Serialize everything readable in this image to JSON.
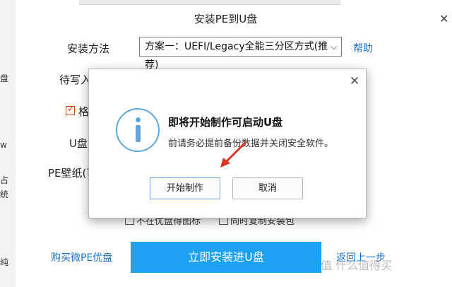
{
  "background_fragments": [
    "盘",
    "w",
    "占",
    "统",
    "纯"
  ],
  "window": {
    "title": "安装PE到U盘",
    "close_glyph": "✕"
  },
  "form": {
    "method_label": "安装方法",
    "method_value": "方案一：UEFI/Legacy全能三分区方式(推荐)",
    "help_link": "帮助",
    "target_label": "待写入",
    "format_label": "格",
    "udisk_label": "U盘",
    "wallpaper_label": "PE壁纸(可",
    "option_a": "不在优盘得图标",
    "option_b": "同时复制安装包"
  },
  "footer": {
    "buy_link": "购买微PE优盘",
    "install_button": "立即安装进U盘",
    "back_link": "返回上一步",
    "watermark": "值 什么值得买"
  },
  "dialog": {
    "close_glyph": "✕",
    "title": "即将开始制作可启动U盘",
    "message": "前请务必提前备份数据并关闭安全软件。",
    "start_button": "开始制作",
    "cancel_button": "取消"
  },
  "colors": {
    "link": "#1a73c8",
    "install_button": "#1da1f2",
    "info_icon": "#5ea6dc",
    "annotation_arrow": "#e0341f"
  }
}
